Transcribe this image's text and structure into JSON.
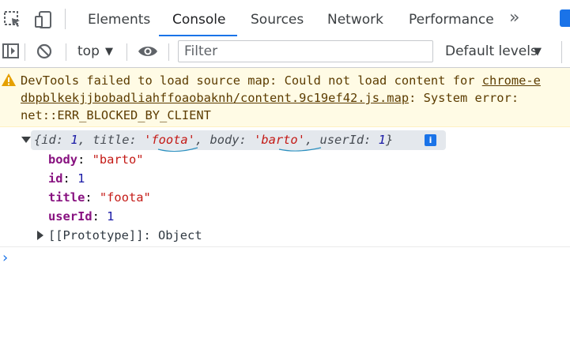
{
  "tabs": [
    "Elements",
    "Console",
    "Sources",
    "Network",
    "Performance"
  ],
  "more_tabs": "»",
  "toolbar": {
    "context": "top",
    "filter_placeholder": "Filter",
    "levels": "Default levels"
  },
  "warning": {
    "prefix": "DevTools failed to load source map: Could not load content for ",
    "link1": "chrome-e",
    "link2": "dbpblkekjjbobadliahffoaobaknh/content.9c19ef42.js.map",
    "after_link": ": System error:",
    "line3": "net::ERR_BLOCKED_BY_CLIENT"
  },
  "object": {
    "summary": {
      "open": "{",
      "k1": "id: ",
      "v1": "1",
      "s1": ", ",
      "k2": "title: ",
      "v2": "'foota'",
      "s2": ", ",
      "k3": "body: ",
      "v3": "'barto'",
      "s3": ", ",
      "k4": "userId: ",
      "v4": "1",
      "close": "}"
    },
    "info_badge": "i",
    "props": [
      {
        "key": "body",
        "value": "\"barto\""
      },
      {
        "key": "id",
        "value": "1"
      },
      {
        "key": "title",
        "value": "\"foota\""
      },
      {
        "key": "userId",
        "value": "1"
      }
    ],
    "prototype": "[[Prototype]]: Object"
  },
  "prompt_symbol": "›",
  "colors": {
    "accent": "#1a73e8",
    "warning_bg": "#fffbe5",
    "warning_text": "#5c3c00",
    "key": "#881280",
    "string": "#c41a16",
    "number": "#1a1aa6"
  }
}
